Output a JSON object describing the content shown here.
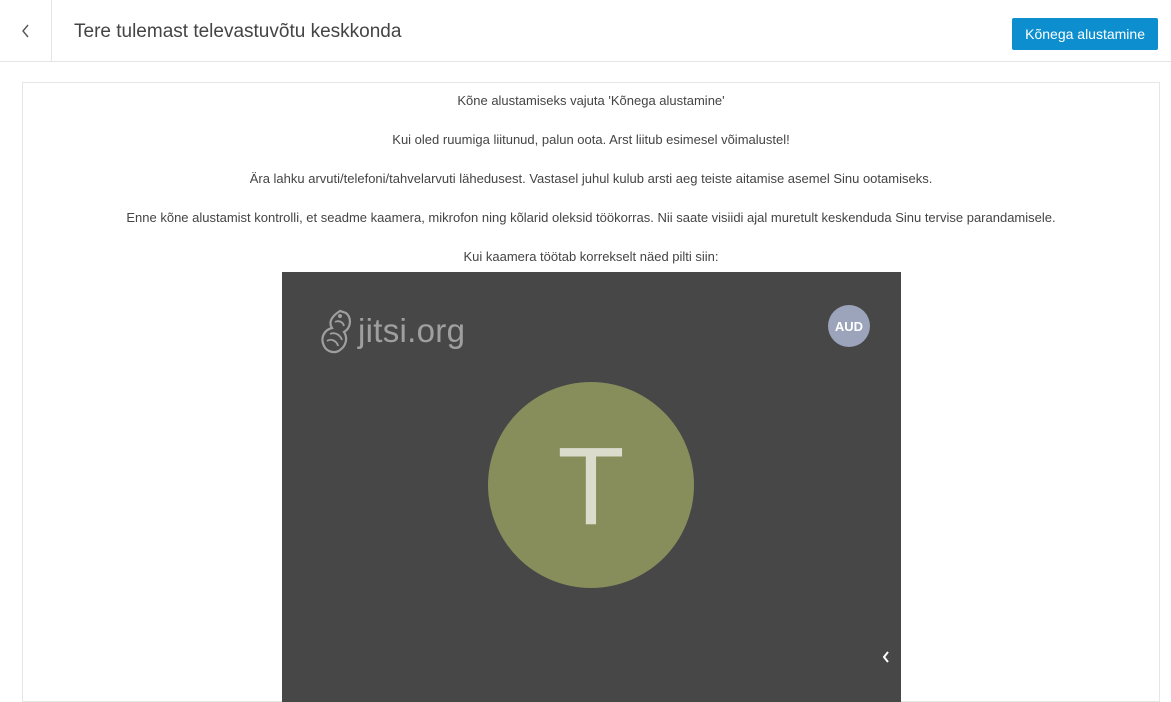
{
  "header": {
    "title": "Tere tulemast televastuvõtu keskkonda",
    "start_call_label": "Kõnega alustamine"
  },
  "instructions": [
    "Kõne alustamiseks vajuta 'Kõnega alustamine'",
    "Kui oled ruumiga liitunud, palun oota. Arst liitub esimesel võimalustel!",
    "Ära lahku arvuti/telefoni/tahvelarvuti lähedusest. Vastasel juhul kulub arsti aeg teiste aitamise asemel Sinu ootamiseks.",
    "Enne kõne alustamist kontrolli, et seadme kaamera, mikrofon ning kõlarid oleksid töökorras. Nii saate visiidi ajal muretult keskenduda Sinu tervise parandamisele.",
    "Kui kaamera töötab korrekselt näed pilti siin:"
  ],
  "video": {
    "watermark_text": "jitsi.org",
    "audio_badge": "AUD",
    "avatar_letter": "T"
  },
  "icons": {
    "back": "chevron-left-icon",
    "logo": "jitsi-logo-icon",
    "collapse": "chevron-left-icon"
  },
  "colors": {
    "accent": "#0d8fcf",
    "video_background": "#474747",
    "avatar": "#878e5b",
    "audio_badge": "#9ba4bb"
  }
}
